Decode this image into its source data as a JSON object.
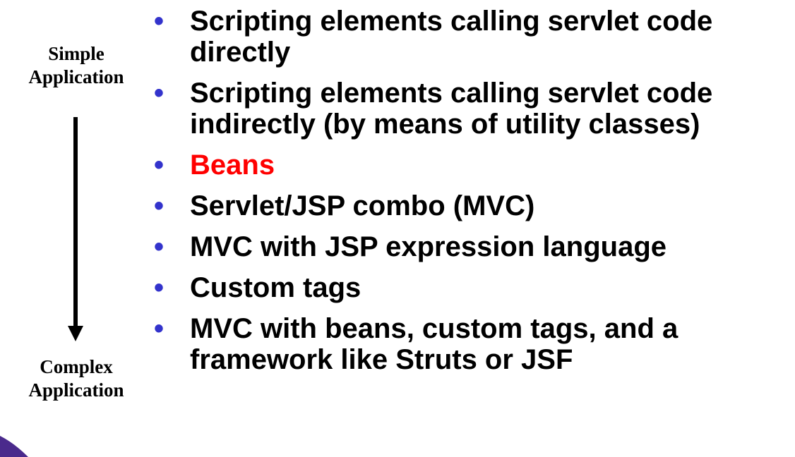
{
  "labels": {
    "top": [
      "Simple",
      "Application"
    ],
    "bottom": [
      "Complex",
      "Application"
    ]
  },
  "bullet_symbol": "•",
  "bullets": [
    {
      "text": "Scripting elements calling servlet code directly"
    },
    {
      "text": "Scripting elements calling servlet code indirectly (by means of utility classes)"
    },
    {
      "text": "Beans",
      "highlight": true
    },
    {
      "text": "Servlet/JSP combo (MVC)"
    },
    {
      "text": "MVC with JSP expression language"
    },
    {
      "text": "Custom tags"
    },
    {
      "text": "MVC with beans, custom tags, and a framework like Struts or JSF"
    }
  ],
  "colors": {
    "bullet": "#3333cc",
    "highlight": "#ff0000",
    "text": "#000000",
    "decor": "#4a2a8c"
  }
}
